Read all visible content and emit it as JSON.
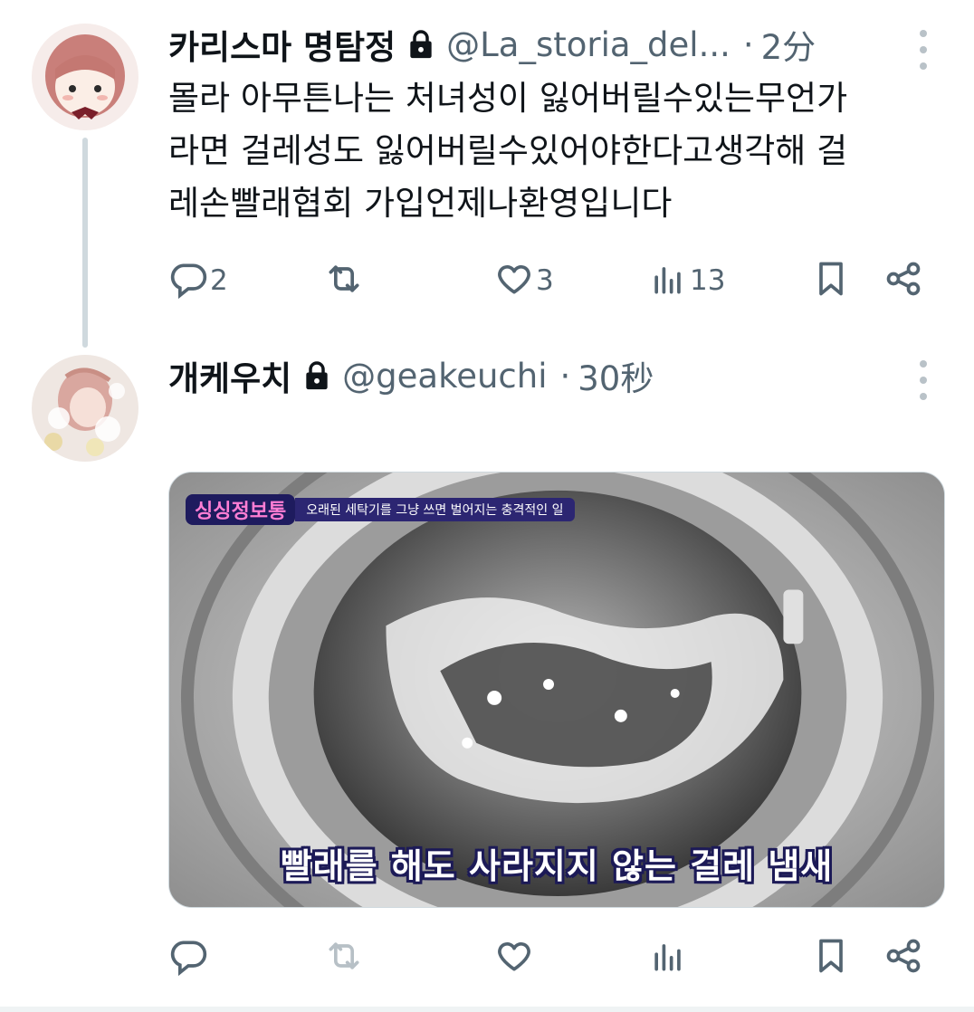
{
  "tweet1": {
    "display_name": "카리스마 명탐정",
    "handle": "@La_storia_del...",
    "separator": "·",
    "time": "2分",
    "text_lines": [
      "몰라 아무튼나는 처녀성이 잃어버릴수있는무언가",
      "라면 걸레성도 잃어버릴수있어야한다고생각해 걸",
      "레손빨래협회 가입언제나환영입니다"
    ],
    "actions": {
      "reply_count": "2",
      "retweet_count": "",
      "like_count": "3",
      "views_count": "13"
    }
  },
  "tweet2": {
    "display_name": "개케우치",
    "handle": "@geakeuchi",
    "separator": "·",
    "time": "30秒",
    "media": {
      "badge_brand": "싱싱정보통",
      "badge_subtitle": "오래된 세탁기를 그냥 쓰면 벌어지는 충격적인 일",
      "caption": "빨래를 해도 사라지지 않는 걸레 냄새"
    },
    "actions": {
      "reply_count": "",
      "retweet_count": "",
      "like_count": "",
      "views_count": ""
    }
  },
  "icons": {
    "reply": "reply-icon",
    "retweet": "retweet-icon",
    "like": "heart-icon",
    "views": "views-icon",
    "bookmark": "bookmark-icon",
    "share": "share-icon",
    "lock": "lock-icon",
    "more": "more-options-icon"
  },
  "colors": {
    "text_primary": "#0f1419",
    "text_secondary": "#536471",
    "thread_line": "#cfd9de"
  }
}
